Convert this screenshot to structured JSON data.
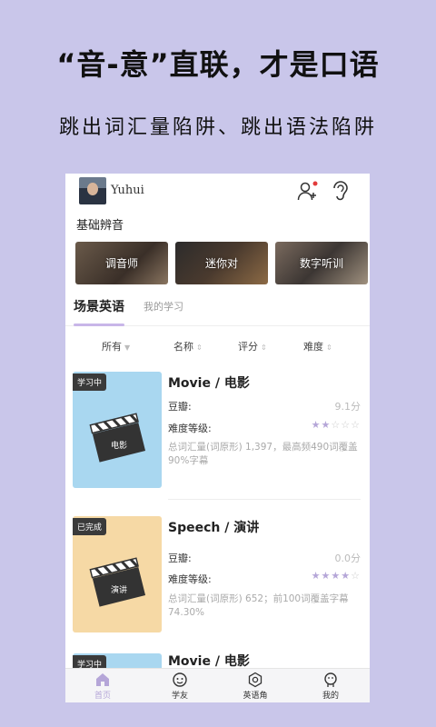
{
  "promo": {
    "title": "“音-意”直联，才是口语",
    "subtitle": "跳出词汇量陷阱、跳出语法陷阱"
  },
  "header": {
    "username": "Yuhui"
  },
  "section_label": "基础辨音",
  "cards": [
    {
      "label": "调音师"
    },
    {
      "label": "迷你对"
    },
    {
      "label": "数字听训"
    }
  ],
  "tabs": [
    {
      "label": "场景英语",
      "active": true
    },
    {
      "label": "我的学习",
      "active": false
    }
  ],
  "filters": [
    "所有",
    "名称",
    "评分",
    "难度"
  ],
  "items": [
    {
      "badge": "学习中",
      "clapper_text": "电影",
      "title": "Movie / 电影",
      "rating_label": "豆瓣:",
      "rating_value": "9.1分",
      "difficulty_label": "难度等级:",
      "stars_on": 2,
      "desc": "总词汇量(词原形) 1,397，最高频490词覆盖90%字幕",
      "thumb_color": "#a9d7f0"
    },
    {
      "badge": "已完成",
      "clapper_text": "演讲",
      "title": "Speech / 演讲",
      "rating_label": "豆瓣:",
      "rating_value": "0.0分",
      "difficulty_label": "难度等级:",
      "stars_on": 4,
      "desc": "总词汇量(词原形) 652；前100词覆盖字幕74.30%",
      "thumb_color": "#f6d9a5"
    },
    {
      "badge": "学习中",
      "title": "Movie / 电影"
    }
  ],
  "bottom_nav": [
    {
      "label": "首页",
      "active": true,
      "icon": "home-icon"
    },
    {
      "label": "学友",
      "active": false,
      "icon": "friends-icon"
    },
    {
      "label": "英语角",
      "active": false,
      "icon": "corner-icon"
    },
    {
      "label": "我的",
      "active": false,
      "icon": "profile-icon"
    }
  ],
  "colors": {
    "background": "#c9c6ea",
    "accent": "#b5a6d8"
  }
}
